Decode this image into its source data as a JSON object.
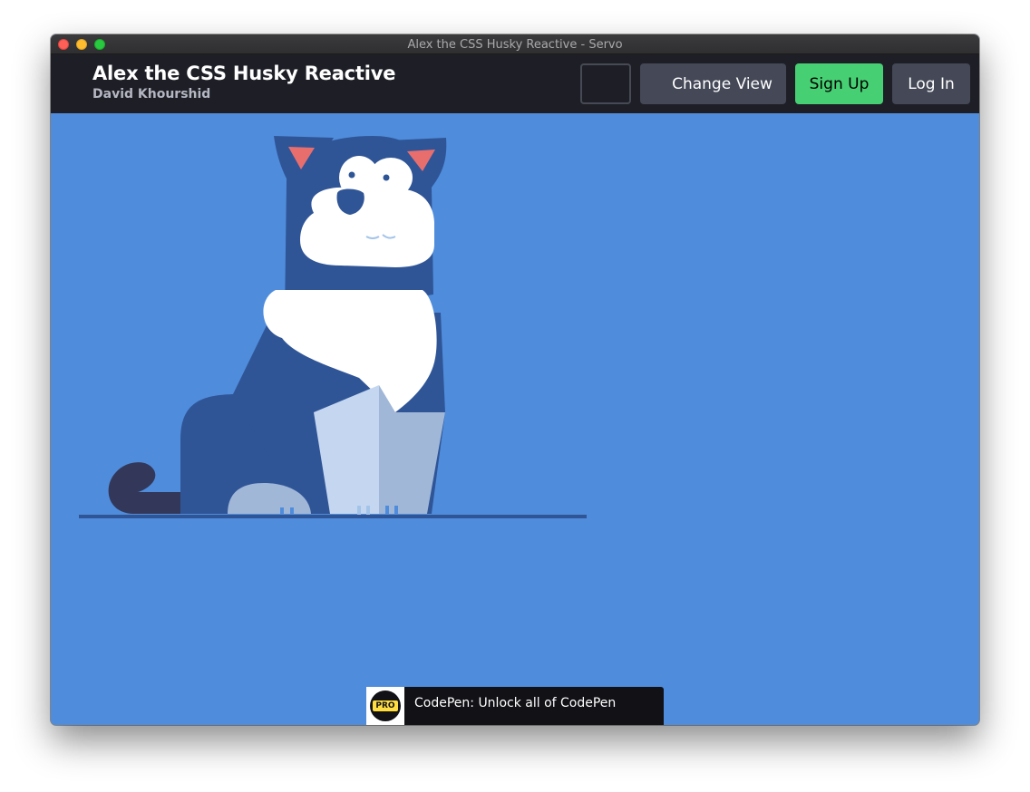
{
  "window": {
    "title": "Alex the CSS Husky Reactive - Servo"
  },
  "header": {
    "pen_title": "Alex the CSS Husky Reactive",
    "author": "David Khourshid",
    "buttons": {
      "change_view": "Change View",
      "sign_up": "Sign Up",
      "log_in": "Log In"
    }
  },
  "promo": {
    "badge": "PRO",
    "text": "CodePen: Unlock all of CodePen"
  },
  "colors": {
    "stage_background": "#4f8ddc",
    "header_background": "#1e1f26",
    "husky_body": "#2f5597",
    "husky_tail": "#33385a",
    "sign_up": "#47cf73",
    "button_dark": "#444857"
  }
}
